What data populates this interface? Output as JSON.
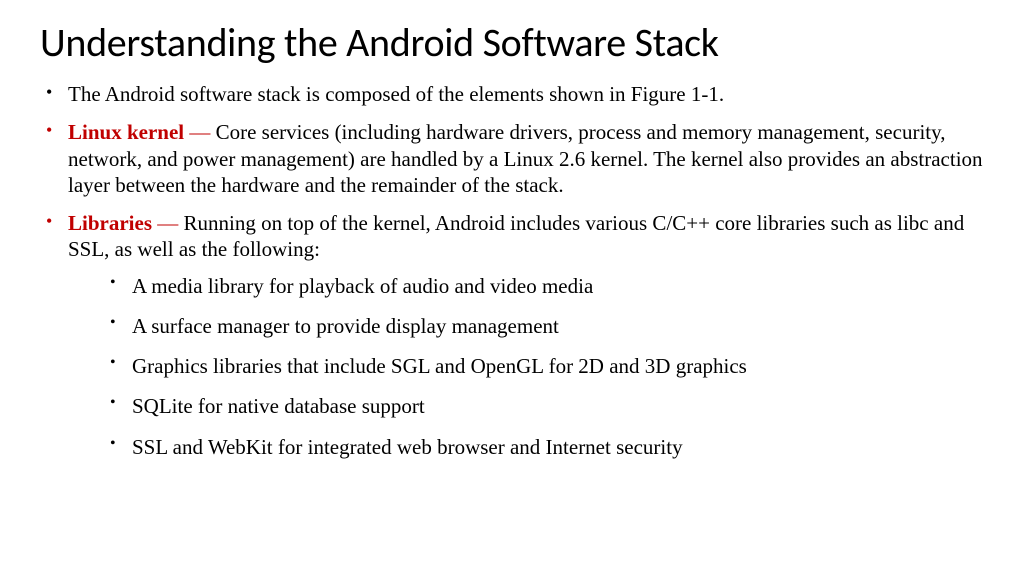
{
  "title": "Understanding the Android Software Stack",
  "bullets": {
    "intro": "The Android software stack is composed of the elements shown in Figure 1-1.",
    "kernel_term": "Linux kernel",
    "kernel_dash": " — ",
    "kernel_desc": "Core services (including hardware drivers, process and memory management, security, network, and power management) are handled by a Linux 2.6 kernel. The kernel also provides an abstraction layer between the hardware and the remainder of the stack.",
    "libs_term": "Libraries",
    "libs_dash": " — ",
    "libs_desc": "Running on top of the kernel, Android includes various C/C++ core libraries such as libc and SSL, as well as the following:"
  },
  "sub_bullets": {
    "media": "A media library for playback of audio and video media",
    "surface": "A surface manager to provide display management",
    "graphics": "Graphics libraries that include SGL and OpenGL for 2D and 3D graphics",
    "sqlite": "SQLite for native database support",
    "ssl": "SSL and WebKit for integrated web browser and Internet security"
  }
}
